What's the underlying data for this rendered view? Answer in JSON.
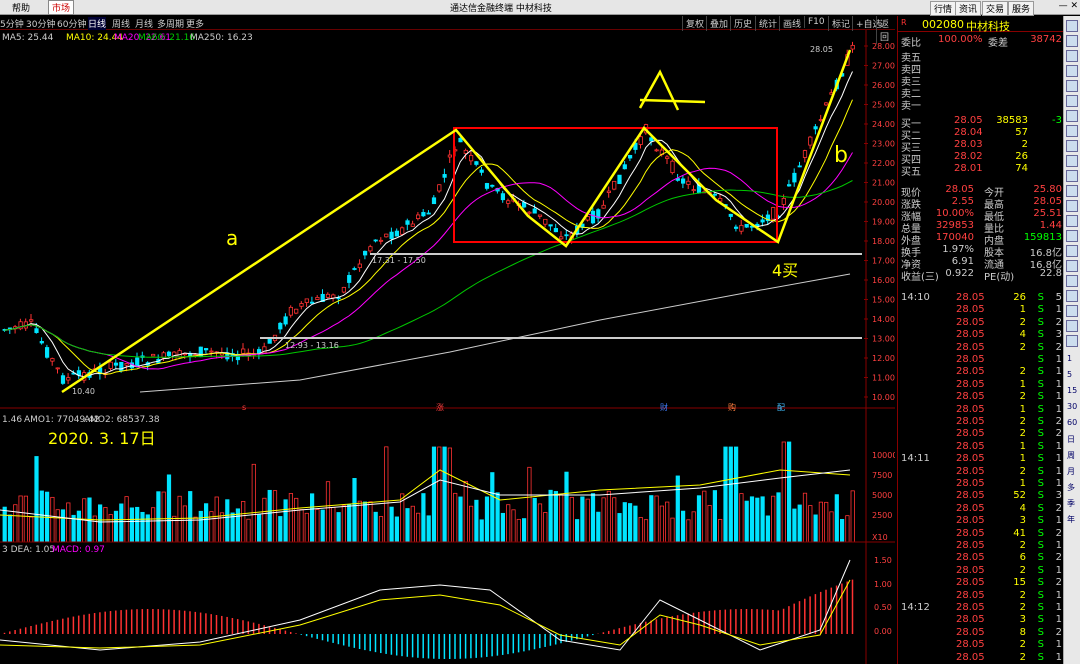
{
  "topbar": {
    "help": "帮助",
    "market": "市场",
    "title": "通达信金融终端  中材科技",
    "quote": "行情",
    "info": "资讯",
    "trade": "交易",
    "service": "服务"
  },
  "periods": [
    "5分钟",
    "30分钟",
    "60分钟",
    "日线",
    "周线",
    "月线",
    "多周期",
    "更多"
  ],
  "tools": [
    "复权",
    "叠加",
    "历史",
    "统计",
    "画线",
    "F10",
    "标记",
    "+自选",
    "返回"
  ],
  "ma_line": {
    "ma5": "MA5: 25.44",
    "ma10": "MA10: 24.44",
    "ma20": "MA20: 22.61",
    "ma60": "MA60: 21.16",
    "ma250": "MA250: 16.23"
  },
  "vol_line": {
    "v": "1.46",
    "amo1": "AMO1: 77049.42",
    "amo2": "AMO2: 68537.38"
  },
  "macd_line": {
    "dea": "3  DEA: 1.05",
    "macd": "MACD: 0.97"
  },
  "price_axis": [
    "28.00",
    "27.00",
    "26.00",
    "25.00",
    "24.00",
    "23.00",
    "22.00",
    "21.00",
    "20.00",
    "19.00",
    "18.00",
    "17.00",
    "16.00",
    "15.00",
    "14.00",
    "13.00",
    "12.00",
    "11.00",
    "10.00"
  ],
  "vol_axis": [
    "10000",
    "7500",
    "5000",
    "2500",
    "X10"
  ],
  "macd_axis": [
    "1.50",
    "1.00",
    "0.50",
    "0.00"
  ],
  "annotations": {
    "high_label": "28.05",
    "low_label": "10.40",
    "range1": "17.31 - 17.50",
    "range2": "12.93 - 13.16",
    "letter_a": "a",
    "letter_A": "A",
    "letter_b": "b",
    "buy4": "4买",
    "date": "2020. 3. 17日",
    "marker_s": "s",
    "marker_up": "涨",
    "marker_cai": "财",
    "marker_gou": "购",
    "marker_pei": "配"
  },
  "stock": {
    "code": "002080",
    "name": "中材科技",
    "wei_bi_label": "委比",
    "wei_bi": "100.00%",
    "wei_cha_label": "委差",
    "wei_cha": "38742",
    "sells": [
      "卖五",
      "卖四",
      "卖三",
      "卖二",
      "卖一"
    ],
    "buys": [
      {
        "label": "买一",
        "price": "28.05",
        "vol": "38583",
        "chg": "-3"
      },
      {
        "label": "买二",
        "price": "28.04",
        "vol": "57",
        "chg": ""
      },
      {
        "label": "买三",
        "price": "28.03",
        "vol": "2",
        "chg": ""
      },
      {
        "label": "买四",
        "price": "28.02",
        "vol": "26",
        "chg": ""
      },
      {
        "label": "买五",
        "price": "28.01",
        "vol": "74",
        "chg": ""
      }
    ],
    "stats": [
      {
        "l1": "现价",
        "v1": "28.05",
        "l2": "今开",
        "v2": "25.80"
      },
      {
        "l1": "涨跌",
        "v1": "2.55",
        "l2": "最高",
        "v2": "28.05"
      },
      {
        "l1": "涨幅",
        "v1": "10.00%",
        "l2": "最低",
        "v2": "25.51"
      },
      {
        "l1": "总量",
        "v1": "329853",
        "l2": "量比",
        "v2": "1.44"
      },
      {
        "l1": "外盘",
        "v1": "170040",
        "l2": "内盘",
        "v2": "159813"
      },
      {
        "l1": "换手",
        "v1": "1.97%",
        "l2": "股本",
        "v2": "16.8亿"
      },
      {
        "l1": "净资",
        "v1": "6.91",
        "l2": "流通",
        "v2": "16.8亿"
      },
      {
        "l1": "收益(三)",
        "v1": "0.922",
        "l2": "PE(动)",
        "v2": "22.8"
      }
    ],
    "ticks": [
      {
        "t": "14:10",
        "p": "28.05",
        "v": "26",
        "d": "S",
        "n": "5"
      },
      {
        "t": "",
        "p": "28.05",
        "v": "1",
        "d": "S",
        "n": "1"
      },
      {
        "t": "",
        "p": "28.05",
        "v": "2",
        "d": "S",
        "n": "2"
      },
      {
        "t": "",
        "p": "28.05",
        "v": "4",
        "d": "S",
        "n": "3"
      },
      {
        "t": "",
        "p": "28.05",
        "v": "2",
        "d": "S",
        "n": "2"
      },
      {
        "t": "",
        "p": "28.05",
        "v": "",
        "d": "S",
        "n": "1"
      },
      {
        "t": "",
        "p": "28.05",
        "v": "2",
        "d": "S",
        "n": "1"
      },
      {
        "t": "",
        "p": "28.05",
        "v": "1",
        "d": "S",
        "n": "1"
      },
      {
        "t": "",
        "p": "28.05",
        "v": "2",
        "d": "S",
        "n": "1"
      },
      {
        "t": "",
        "p": "28.05",
        "v": "1",
        "d": "S",
        "n": "1"
      },
      {
        "t": "",
        "p": "28.05",
        "v": "2",
        "d": "S",
        "n": "2"
      },
      {
        "t": "",
        "p": "28.05",
        "v": "2",
        "d": "S",
        "n": "2"
      },
      {
        "t": "",
        "p": "28.05",
        "v": "1",
        "d": "S",
        "n": "1"
      },
      {
        "t": "14:11",
        "p": "28.05",
        "v": "1",
        "d": "S",
        "n": "1"
      },
      {
        "t": "",
        "p": "28.05",
        "v": "2",
        "d": "S",
        "n": "1"
      },
      {
        "t": "",
        "p": "28.05",
        "v": "1",
        "d": "S",
        "n": "1"
      },
      {
        "t": "",
        "p": "28.05",
        "v": "52",
        "d": "S",
        "n": "3"
      },
      {
        "t": "",
        "p": "28.05",
        "v": "4",
        "d": "S",
        "n": "2"
      },
      {
        "t": "",
        "p": "28.05",
        "v": "3",
        "d": "S",
        "n": "1"
      },
      {
        "t": "",
        "p": "28.05",
        "v": "41",
        "d": "S",
        "n": "2"
      },
      {
        "t": "",
        "p": "28.05",
        "v": "2",
        "d": "S",
        "n": "1"
      },
      {
        "t": "",
        "p": "28.05",
        "v": "6",
        "d": "S",
        "n": "2"
      },
      {
        "t": "",
        "p": "28.05",
        "v": "2",
        "d": "S",
        "n": "1"
      },
      {
        "t": "",
        "p": "28.05",
        "v": "15",
        "d": "S",
        "n": "2"
      },
      {
        "t": "",
        "p": "28.05",
        "v": "2",
        "d": "S",
        "n": "1"
      },
      {
        "t": "14:12",
        "p": "28.05",
        "v": "2",
        "d": "S",
        "n": "1"
      },
      {
        "t": "",
        "p": "28.05",
        "v": "3",
        "d": "S",
        "n": "1"
      },
      {
        "t": "",
        "p": "28.05",
        "v": "8",
        "d": "S",
        "n": "2"
      },
      {
        "t": "",
        "p": "28.05",
        "v": "2",
        "d": "S",
        "n": "1"
      },
      {
        "t": "",
        "p": "28.05",
        "v": "2",
        "d": "S",
        "n": "1"
      }
    ]
  },
  "sidebar_labels": [
    "1",
    "5",
    "15",
    "30",
    "60",
    "日",
    "周",
    "月",
    "多",
    "季",
    "年"
  ],
  "colors": {
    "up": "#ff3232",
    "down": "#00e4ff",
    "yellow": "#ffff00",
    "ma10": "#ffff00",
    "ma20": "#ff00ff",
    "ma60": "#00c800"
  }
}
